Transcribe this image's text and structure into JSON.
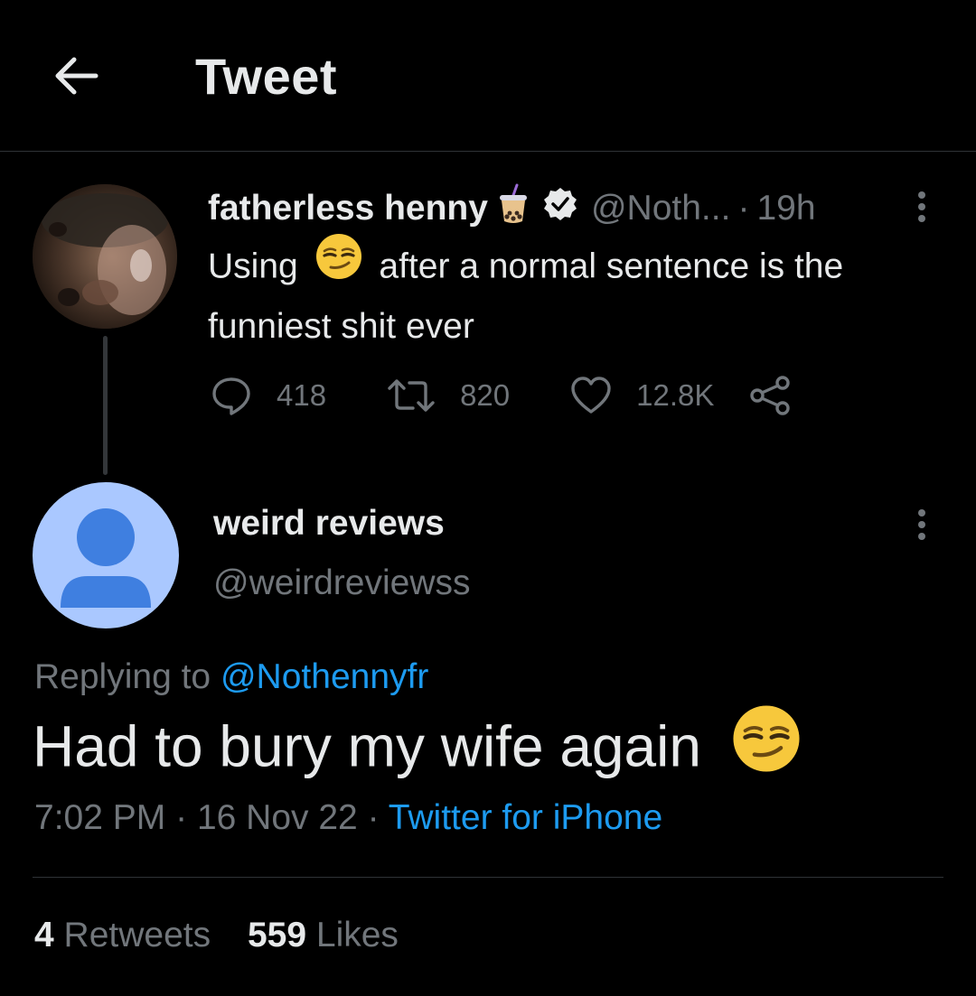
{
  "header": {
    "title": "Tweet",
    "back_icon": "arrow-left-icon"
  },
  "parent_tweet": {
    "name": "fatherless henny",
    "name_emoji": "bubble-tea-icon",
    "verified_icon": "verified-badge-icon",
    "handle": "@Noth...",
    "separator": "·",
    "time": "19h",
    "text_before": "Using",
    "text_emoji": "smirking-face-icon",
    "text_after": "after a normal sentence is the funniest shit ever",
    "actions": {
      "replies": "418",
      "retweets": "820",
      "likes": "12.8K"
    }
  },
  "reply_tweet": {
    "name": "weird reviews",
    "handle": "@weirdreviewss",
    "replying_label": "Replying to",
    "replying_handle": "@Nothennyfr",
    "text": "Had to bury my wife again",
    "text_emoji": "smirking-face-icon",
    "time": "7:02 PM",
    "sep1": "·",
    "date": "16 Nov 22",
    "sep2": "·",
    "source": "Twitter for iPhone",
    "retweets_count": "4",
    "retweets_label": "Retweets",
    "likes_count": "559",
    "likes_label": "Likes"
  },
  "colors": {
    "background": "#000000",
    "text": "#e7e9ea",
    "secondary": "#71767b",
    "link": "#1d9bf0",
    "divider": "#2f3336",
    "default_avatar_bg": "#aac8ff",
    "default_avatar_fg": "#3f7fe0"
  }
}
